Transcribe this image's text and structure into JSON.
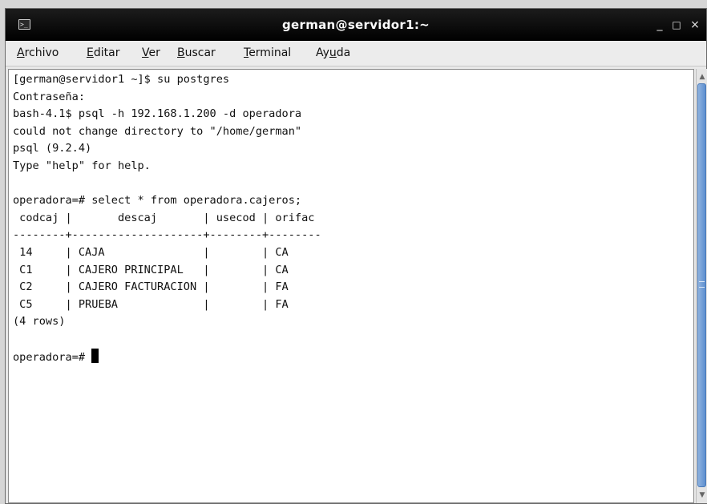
{
  "window": {
    "title": "german@servidor1:~",
    "icon": "terminal-icon",
    "controls": {
      "minimize": "_",
      "maximize": "□",
      "close": "×"
    }
  },
  "menu": {
    "items": [
      "Archivo",
      "Editar",
      "Ver",
      "Buscar",
      "Terminal",
      "Ayuda"
    ],
    "mnemonics": [
      "A",
      "E",
      "V",
      "B",
      "T",
      "u"
    ]
  },
  "terminal": {
    "lines": [
      "[german@servidor1 ~]$ su postgres",
      "Contraseña:",
      "bash-4.1$ psql -h 192.168.1.200 -d operadora",
      "could not change directory to \"/home/german\"",
      "psql (9.2.4)",
      "Type \"help\" for help.",
      "",
      "operadora=# select * from operadora.cajeros;",
      " codcaj |       descaj       | usecod | orifac ",
      "--------+--------------------+--------+--------",
      " 14     | CAJA               |        | CA",
      " C1     | CAJERO PRINCIPAL   |        | CA",
      " C2     | CAJERO FACTURACION |        | FA",
      " C5     | PRUEBA             |        | FA",
      "(4 rows)",
      ""
    ],
    "prompt": "operadora=# "
  },
  "colors": {
    "titlebar": "#000000",
    "scroll_thumb": "#5d8fcf"
  }
}
